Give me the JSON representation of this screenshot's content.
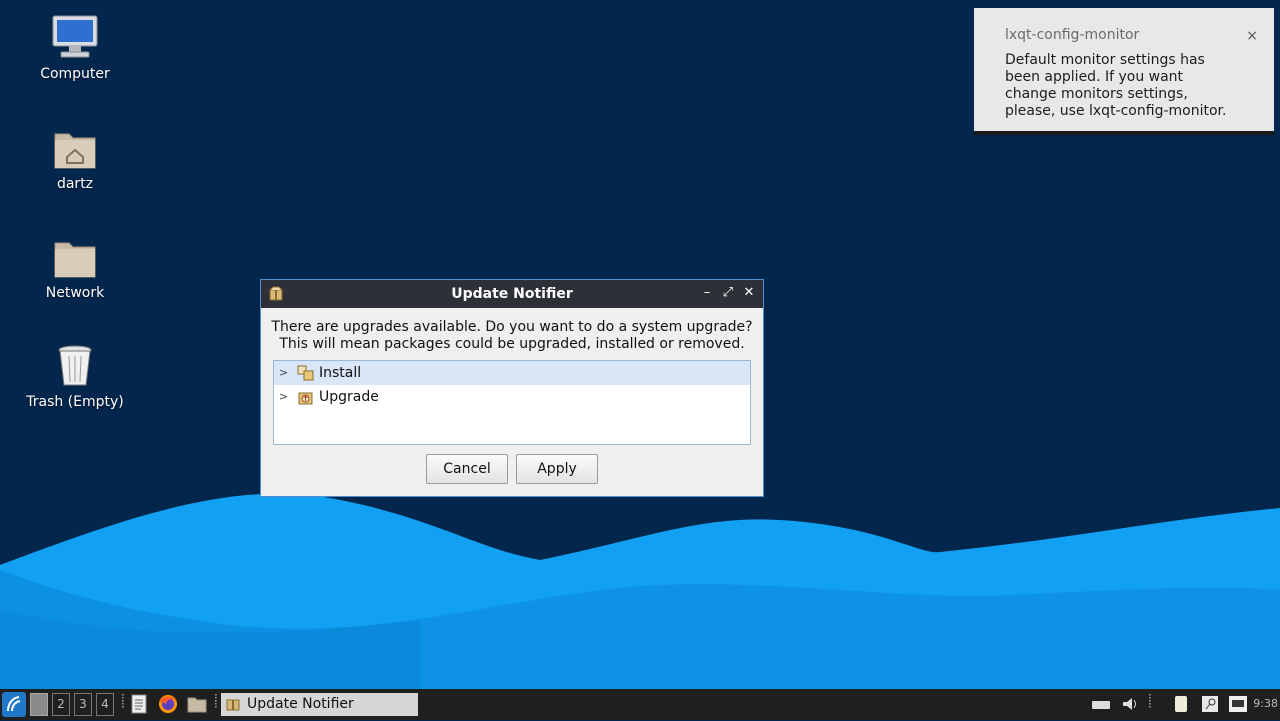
{
  "desktop": {
    "icons": [
      {
        "label": "Computer"
      },
      {
        "label": "dartz"
      },
      {
        "label": "Network"
      },
      {
        "label": "Trash (Empty)"
      }
    ]
  },
  "notification": {
    "title": "lxqt-config-monitor",
    "close": "×",
    "body_lines": [
      "Default monitor settings has",
      "been applied. If you want",
      "change monitors settings,",
      "please, use lxqt-config-monitor."
    ]
  },
  "dialog": {
    "title": "Update Notifier",
    "message_lines": [
      "There are upgrades available. Do you want to do a system upgrade?",
      "This will mean packages could be upgraded, installed or removed."
    ],
    "tree_items": [
      {
        "label": "Install",
        "selected": true
      },
      {
        "label": "Upgrade",
        "selected": false
      }
    ],
    "buttons": {
      "cancel": "Cancel",
      "apply": "Apply"
    },
    "window_controls": {
      "minimize": "–",
      "maximize": "⤢",
      "close": "✕"
    }
  },
  "taskbar": {
    "workspaces": [
      "",
      "2",
      "3",
      "4"
    ],
    "active_workspace": 1,
    "window_button": "Update Notifier",
    "clock": "9:38"
  },
  "colors": {
    "desktop_bg": "#03264d",
    "wave_light": "#1a9ef0",
    "wave_mid": "#0f86d8",
    "titlebar": "#2d3036",
    "taskbar": "#1f1f1f"
  }
}
